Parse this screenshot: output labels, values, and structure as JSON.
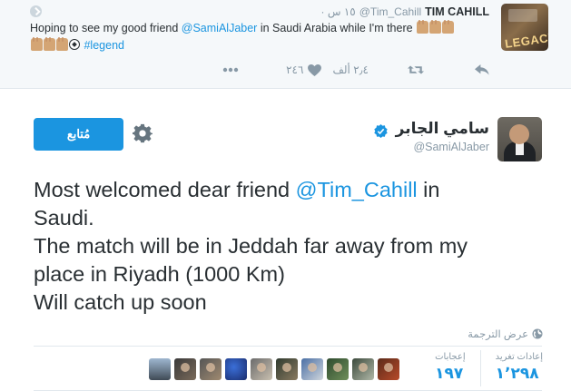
{
  "parent_tweet": {
    "author_name": "TIM CAHILL",
    "author_handle": "@Tim_Cahill",
    "timestamp": "١٥ س ·",
    "avatar_text": "LEGACY",
    "text_before_mention": "Hoping to see my good friend ",
    "mention": "@SamiAlJaber",
    "text_after_mention": " in Saudi Arabia while I'm there ",
    "hashtag": "#legend",
    "emoji": "raised-hands-emoji, soccer-ball-emoji",
    "actions": {
      "reply_icon": "reply-icon",
      "retweet_icon": "retweet-icon",
      "retweet_count": "٢٫٤ ألف",
      "like_icon": "heart-icon",
      "like_count": "٢٤٦",
      "more_icon": "more-dots-icon"
    }
  },
  "main_tweet": {
    "author_name": "سامي الجابر",
    "author_handle": "@SamiAlJaber",
    "verified_icon": "verified-badge-icon",
    "follow_label": "مُتابع",
    "settings_icon": "gear-icon",
    "text_lines": [
      {
        "before": "Most welcomed dear friend ",
        "mention": "@Tim_Cahill",
        "after": " in"
      },
      {
        "text": "Saudi."
      },
      {
        "text": "The match will be in Jeddah far away from my"
      },
      {
        "text": "place in Riyadh (1000 Km)"
      },
      {
        "text": "Will catch up soon"
      }
    ],
    "translate_label": "عرض الترجمة",
    "translate_icon": "globe-icon",
    "stats": {
      "retweets_label": "إعادات تغريد",
      "retweets_value": "١٬٢٩٨",
      "likes_label": "إعجابات",
      "likes_value": "١٩٧"
    },
    "likers": [
      "avatar",
      "avatar",
      "avatar",
      "avatar",
      "avatar",
      "avatar",
      "avatar",
      "avatar",
      "avatar",
      "avatar"
    ]
  },
  "colors": {
    "link_blue": "#1b95e0",
    "muted_gray": "#8899a6",
    "text_dark": "#292f33",
    "parent_bg": "#f5f8fa"
  }
}
